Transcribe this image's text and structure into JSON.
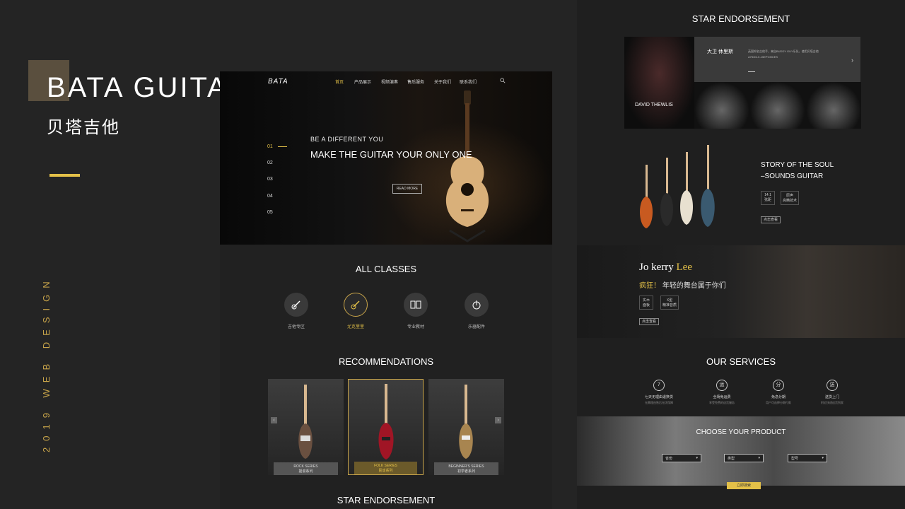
{
  "intro": {
    "brand": "BATA GUITAR",
    "brand_cn": "贝塔吉他",
    "vertical": "2019 WEB DESIGN"
  },
  "colors": {
    "accent": "#e3c048",
    "bg": "#242424"
  },
  "mock": {
    "nav": {
      "logo": "BATA",
      "items": [
        "首页",
        "产品展示",
        "视频演奏",
        "售后服务",
        "关于我们",
        "联系我们"
      ],
      "active_index": 0
    },
    "hero": {
      "subtitle": "BE A DIFFERENT YOU",
      "title": "MAKE THE GUITAR YOUR ONLY ONE",
      "button": "READ MORE",
      "slides": [
        "01",
        "02",
        "03",
        "04",
        "05"
      ]
    },
    "classes": {
      "title": "ALL CLASSES",
      "items": [
        {
          "label": "吉他专区",
          "icon": "guitar-icon"
        },
        {
          "label": "尤克里里",
          "icon": "ukulele-icon",
          "active": true
        },
        {
          "label": "专业教材",
          "icon": "book-icon"
        },
        {
          "label": "乐器配件",
          "icon": "accessory-icon"
        }
      ]
    },
    "recommendations": {
      "title": "RECOMMENDATIONS",
      "items": [
        {
          "en": "ROCK SERIES",
          "cn": "摇滚系列"
        },
        {
          "en": "FOLK SERIES",
          "cn": "民谣系列"
        },
        {
          "en": "BEGINNER'S SERIES",
          "cn": "初学者系列"
        }
      ]
    },
    "star_title": "STAR ENDORSEMENT"
  },
  "right": {
    "star": {
      "title": "STAR ENDORSEMENT",
      "name_cn": "大卫 休里斯",
      "desc": "英国知名吉他手，来自BUDDY GUY乐队，使用贝塔吉他",
      "model": "A7530LX-15EPCMCES",
      "name_en": "DAVID THEWLIS"
    },
    "story": {
      "title_1": "STORY OF THE SOUL",
      "title_2": "–SOUNDS GUITAR",
      "specs": [
        {
          "top": "14:1",
          "bottom": "弦距"
        },
        {
          "top": "原声",
          "bottom": "高精技术"
        }
      ],
      "button": "点击查看"
    },
    "jo": {
      "name_a": "Jo kerry",
      "name_b": "Lee",
      "exclaim": "疯狂！",
      "sub": "年轻的舞台属于你们",
      "specs": [
        {
          "top": "实木",
          "bottom": "面板"
        },
        {
          "top": "X型",
          "bottom": "精准音质"
        }
      ],
      "button": "点击查看"
    },
    "services": {
      "title": "OUR SERVICES",
      "items": [
        {
          "icon": "7",
          "t": "七天无理由退换货",
          "s": "无需理由售后无忧保障"
        },
        {
          "icon": "运",
          "t": "全场免运费",
          "s": "享受免费的送货服务"
        },
        {
          "icon": "分",
          "t": "免息分期",
          "s": "用户可选择分期付款"
        },
        {
          "icon": "送",
          "t": "送货上门",
          "s": "附近快递送货到家"
        }
      ]
    },
    "choose": {
      "title": "CHOOSE YOUR PRODUCT",
      "selects": [
        "省份",
        "类型",
        "型号"
      ],
      "button": "立即搜索"
    }
  }
}
